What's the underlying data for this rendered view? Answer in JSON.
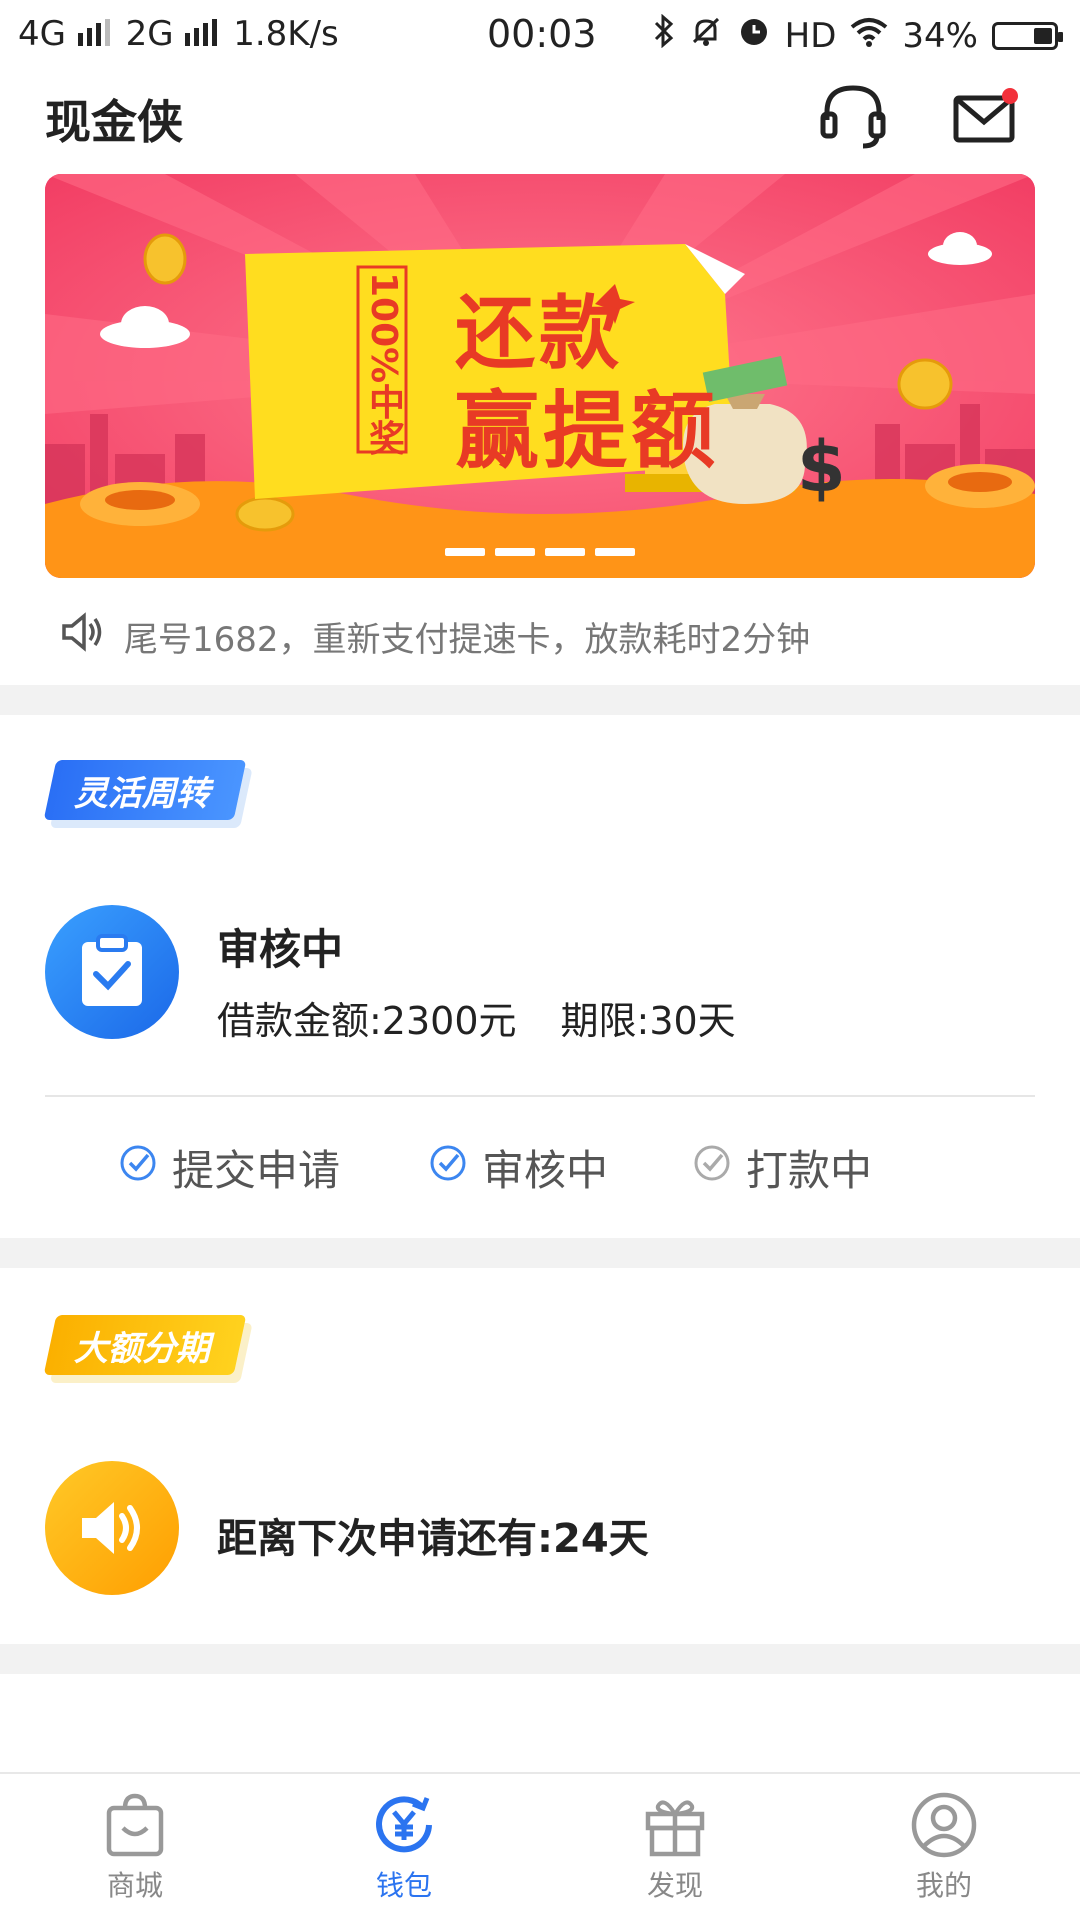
{
  "status_bar": {
    "network_1": "4G",
    "network_2": "2G",
    "speed": "1.8K/s",
    "time": "00:03",
    "hd": "HD",
    "battery_percent": "34%",
    "battery_level": 0.34
  },
  "header": {
    "title": "现金侠",
    "icons": [
      "headset-icon",
      "mail-icon"
    ],
    "mail_has_unread": true
  },
  "banner": {
    "ticket_side": "100%中奖",
    "headline_1": "还款",
    "headline_2": "赢提额",
    "page_count": 4,
    "colors": {
      "bg": "#f24b6f",
      "ticket": "#ffdd1f",
      "text": "#e83a25"
    }
  },
  "notice": {
    "text": "尾号1682，重新支付提速卡，放款耗时2分钟"
  },
  "flexible": {
    "tag": "灵活周转",
    "status_title": "审核中",
    "amount_text": "借款金额:2300元",
    "term_text": "期限:30天",
    "steps": [
      {
        "label": "提交申请",
        "done": true
      },
      {
        "label": "审核中",
        "done": true
      },
      {
        "label": "打款中",
        "done": false
      }
    ]
  },
  "installment": {
    "tag": "大额分期",
    "countdown_text": "距离下次申请还有:24天"
  },
  "tabbar": {
    "items": [
      {
        "label": "商城",
        "icon": "bag-icon",
        "active": false
      },
      {
        "label": "钱包",
        "icon": "wallet-yuan-icon",
        "active": true
      },
      {
        "label": "发现",
        "icon": "gift-icon",
        "active": false
      },
      {
        "label": "我的",
        "icon": "user-icon",
        "active": false
      }
    ]
  },
  "colors": {
    "accent": "#2b74f0",
    "warning": "#ffb000",
    "muted": "#888888"
  }
}
